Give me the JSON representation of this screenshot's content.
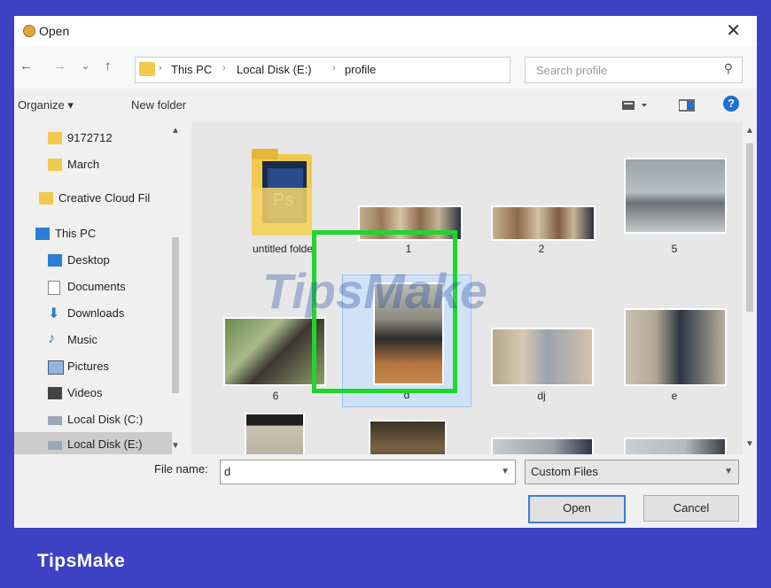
{
  "window": {
    "title": "Open",
    "close_glyph": "✕"
  },
  "nav": {
    "back_glyph": "←",
    "forward_glyph": "→",
    "recent_glyph": "⌄",
    "up_glyph": "↑",
    "breadcrumb": [
      "This PC",
      "Local Disk (E:)",
      "profile"
    ],
    "separator_glyph": "›",
    "refresh_glyph": "↻",
    "search_placeholder": "Search profile"
  },
  "toolbar": {
    "organize_label": "Organize ▾",
    "new_folder_label": "New folder",
    "help_glyph": "?"
  },
  "sidebar": {
    "items": [
      {
        "label": "9172712",
        "icon": "folder-icon",
        "selected": false
      },
      {
        "label": "March",
        "icon": "folder-icon",
        "selected": false
      },
      {
        "label": "Creative Cloud Fil",
        "icon": "creative-cloud-icon",
        "selected": false
      },
      {
        "label": "This PC",
        "icon": "computer-icon",
        "selected": false
      },
      {
        "label": "Desktop",
        "icon": "desktop-icon",
        "selected": false
      },
      {
        "label": "Documents",
        "icon": "documents-icon",
        "selected": false
      },
      {
        "label": "Downloads",
        "icon": "downloads-icon",
        "selected": false
      },
      {
        "label": "Music",
        "icon": "music-icon",
        "selected": false
      },
      {
        "label": "Pictures",
        "icon": "pictures-icon",
        "selected": false
      },
      {
        "label": "Videos",
        "icon": "videos-icon",
        "selected": false
      },
      {
        "label": "Local Disk (C:)",
        "icon": "drive-icon",
        "selected": false
      },
      {
        "label": "Local Disk (E:)",
        "icon": "drive-icon",
        "selected": true
      }
    ]
  },
  "files": [
    {
      "name": "untitled folder",
      "kind": "folder"
    },
    {
      "name": "1",
      "kind": "image"
    },
    {
      "name": "2",
      "kind": "image"
    },
    {
      "name": "5",
      "kind": "image"
    },
    {
      "name": "6",
      "kind": "image"
    },
    {
      "name": "d",
      "kind": "image",
      "selected": true
    },
    {
      "name": "dj",
      "kind": "image"
    },
    {
      "name": "e",
      "kind": "image"
    }
  ],
  "footer": {
    "file_name_label": "File name:",
    "file_name_value": "d",
    "file_type_value": "Custom Files",
    "open_label": "Open",
    "cancel_label": "Cancel"
  },
  "watermark": "TipsMake",
  "brand": "TipsMake",
  "colors": {
    "frame": "#3d41c4",
    "highlight": "#1ed72d",
    "selection": "#cfe2f7"
  }
}
